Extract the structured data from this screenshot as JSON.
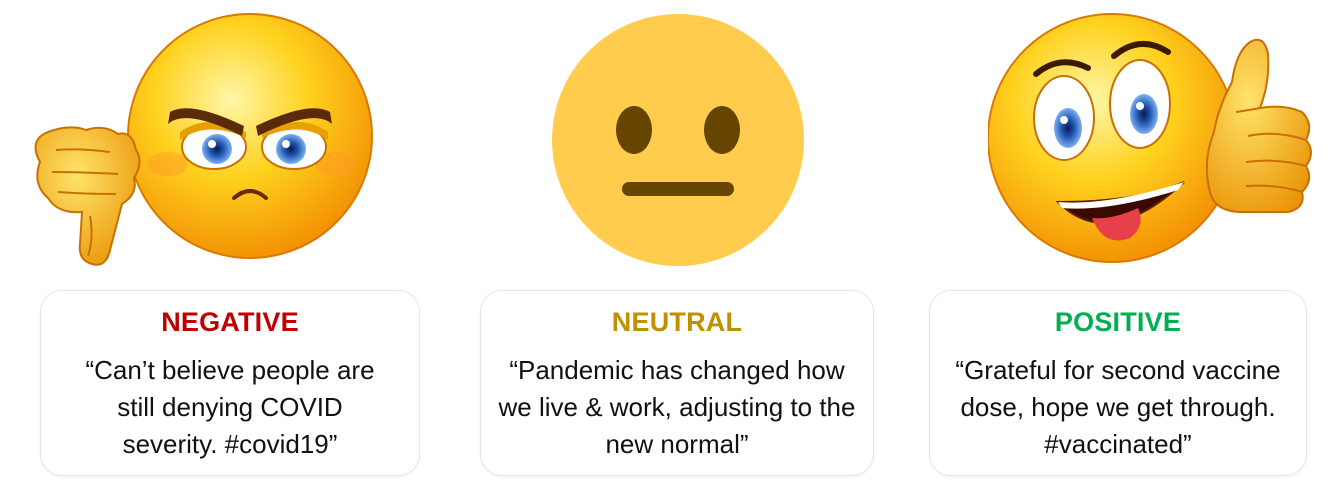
{
  "colors": {
    "negative": "#c00000",
    "neutral": "#bf9000",
    "positive": "#00b050"
  },
  "icons": {
    "negative": "angry-face-thumbs-down-icon",
    "neutral": "neutral-face-icon",
    "positive": "happy-face-thumbs-up-icon"
  },
  "cards": [
    {
      "label": "NEGATIVE",
      "quote": "“Can’t believe people are still denying COVID severity. #covid19”"
    },
    {
      "label": "NEUTRAL",
      "quote": "“Pandemic has changed how we live & work, adjusting to the new normal”"
    },
    {
      "label": "POSITIVE",
      "quote": "“Grateful for second vaccine dose, hope we get through. #vaccinated”"
    }
  ]
}
